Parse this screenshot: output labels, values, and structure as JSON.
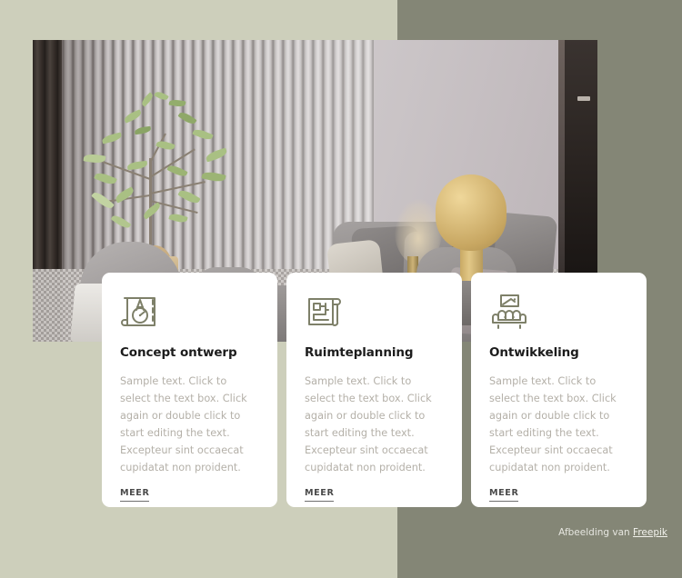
{
  "theme": {
    "bg_dark_sage": "#848676",
    "bg_light_sage": "#cdcfbb",
    "card_bg": "#ffffff",
    "icon_color": "#7e8069",
    "title_color": "#1c1c1c",
    "body_color": "#b4b0a8",
    "link_color": "#4a4a4a"
  },
  "hero": {
    "image_alt": "Modern living room interior with slatted wall, olive tree, grey sectional sofa and brass table lamp"
  },
  "cards": [
    {
      "icon": "drafting-design-icon",
      "title": "Concept ontwerp",
      "body": "Sample text. Click to select the text box. Click again or double click to start editing the text. Excepteur sint occaecat cupidatat non proident.",
      "link_label": "MEER"
    },
    {
      "icon": "floor-plan-icon",
      "title": "Ruimteplanning",
      "body": "Sample text. Click to select the text box. Click again or double click to start editing the text. Excepteur sint occaecat cupidatat non proident.",
      "link_label": "MEER"
    },
    {
      "icon": "sofa-frame-icon",
      "title": "Ontwikkeling",
      "body": "Sample text. Click to select the text box. Click again or double click to start editing the text. Excepteur sint occaecat cupidatat non proident.",
      "link_label": "MEER"
    }
  ],
  "attribution": {
    "prefix": "Afbeelding van",
    "link_label": "Freepik"
  }
}
